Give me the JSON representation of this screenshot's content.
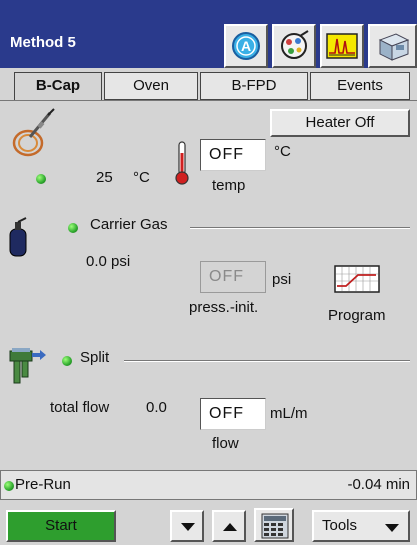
{
  "window": {
    "title": "Method 5"
  },
  "toolbar": {
    "icons": [
      "a-badge-icon",
      "detector-icon",
      "chromatogram-icon",
      "instrument-icon"
    ],
    "colors": {
      "titlebar": "#2a3a8c",
      "accent": "#2e9e2e"
    }
  },
  "tabs": [
    {
      "label": "B-Cap",
      "active": true
    },
    {
      "label": "Oven",
      "active": false
    },
    {
      "label": "B-FPD",
      "active": false
    },
    {
      "label": "Events",
      "active": false
    }
  ],
  "heater": {
    "button_label": "Heater Off",
    "actual_value": "25",
    "actual_unit": "°C",
    "setpoint_value": "OFF",
    "setpoint_unit": "°C",
    "setpoint_caption": "temp"
  },
  "carrier": {
    "section_label": "Carrier Gas",
    "actual_value": "0.0 psi",
    "setpoint_value": "OFF",
    "setpoint_unit": "psi",
    "setpoint_caption": "press.-init.",
    "program_label": "Program"
  },
  "split": {
    "section_label": "Split",
    "total_flow_label": "total flow",
    "total_flow_value": "0.0",
    "setpoint_value": "OFF",
    "setpoint_unit": "mL/m",
    "setpoint_caption": "flow"
  },
  "status": {
    "state": "Pre-Run",
    "time": "-0.04 min"
  },
  "bottom": {
    "start_label": "Start",
    "tools_label": "Tools"
  }
}
